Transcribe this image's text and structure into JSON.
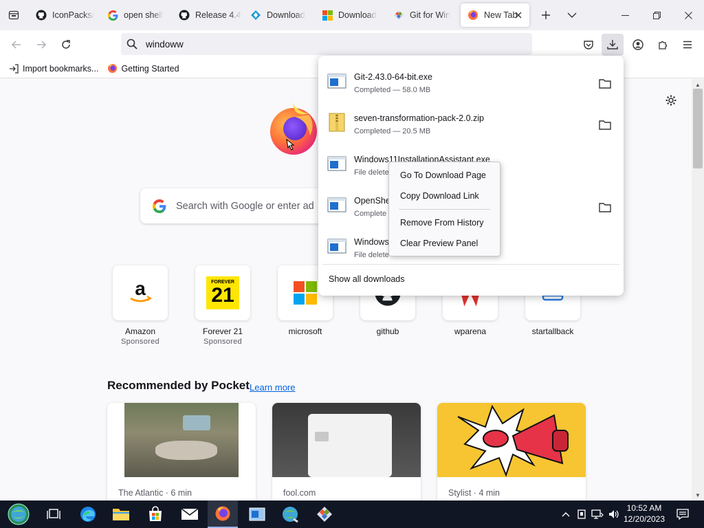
{
  "tabs": [
    {
      "label": "IconPacks/",
      "icon": "github-icon"
    },
    {
      "label": "open shell",
      "icon": "google-icon"
    },
    {
      "label": "Release 4.4",
      "icon": "github-icon"
    },
    {
      "label": "Download",
      "icon": "download-site-icon"
    },
    {
      "label": "Download",
      "icon": "microsoft-icon"
    },
    {
      "label": "Git for Win",
      "icon": "git-icon"
    },
    {
      "label": "New Tab",
      "icon": "firefox-icon",
      "active": true
    }
  ],
  "urlbar": {
    "value": "windoww"
  },
  "bookmarks": [
    {
      "label": "Import bookmarks...",
      "icon": "import-icon"
    },
    {
      "label": "Getting Started",
      "icon": "firefox-icon"
    }
  ],
  "search": {
    "placeholder": "Search with Google or enter ad"
  },
  "top_sites": [
    {
      "name": "Amazon",
      "sub": "Sponsored"
    },
    {
      "name": "Forever 21",
      "sub": "Sponsored",
      "logo_text_top": "FOREVER",
      "logo_text_main": "21"
    },
    {
      "name": "microsoft",
      "sub": ""
    },
    {
      "name": "github",
      "sub": ""
    },
    {
      "name": "wparena",
      "sub": ""
    },
    {
      "name": "startallback",
      "sub": ""
    }
  ],
  "pocket": {
    "title": "Recommended by Pocket",
    "learn_more": "Learn more",
    "cards": [
      {
        "source": "The Atlantic · 6 min"
      },
      {
        "source": "fool.com"
      },
      {
        "source": "Stylist · 4 min"
      }
    ]
  },
  "downloads": {
    "items": [
      {
        "name": "Git-2.43.0-64-bit.exe",
        "status": "Completed — 58.0 MB",
        "type": "exe",
        "folder": true
      },
      {
        "name": "seven-transformation-pack-2.0.zip",
        "status": "Completed — 20.5 MB",
        "type": "zip",
        "folder": true
      },
      {
        "name": "Windows11InstallationAssistant.exe",
        "status": "File delete",
        "type": "exe",
        "folder": false
      },
      {
        "name": "OpenShel",
        "status": "Complete",
        "type": "exe",
        "folder": true
      },
      {
        "name": "Windows",
        "status": "File delete",
        "type": "exe",
        "folder": false
      }
    ],
    "show_all": "Show all downloads"
  },
  "context_menu": {
    "items": [
      "Go To Download Page",
      "Copy Download Link",
      "Remove From History",
      "Clear Preview Panel"
    ]
  },
  "clock": {
    "time": "10:52 AM",
    "date": "12/20/2023"
  },
  "colors": {
    "accent": "#0061e0",
    "taskbar": "#101624",
    "tabstrip": "#f0f0f4"
  }
}
